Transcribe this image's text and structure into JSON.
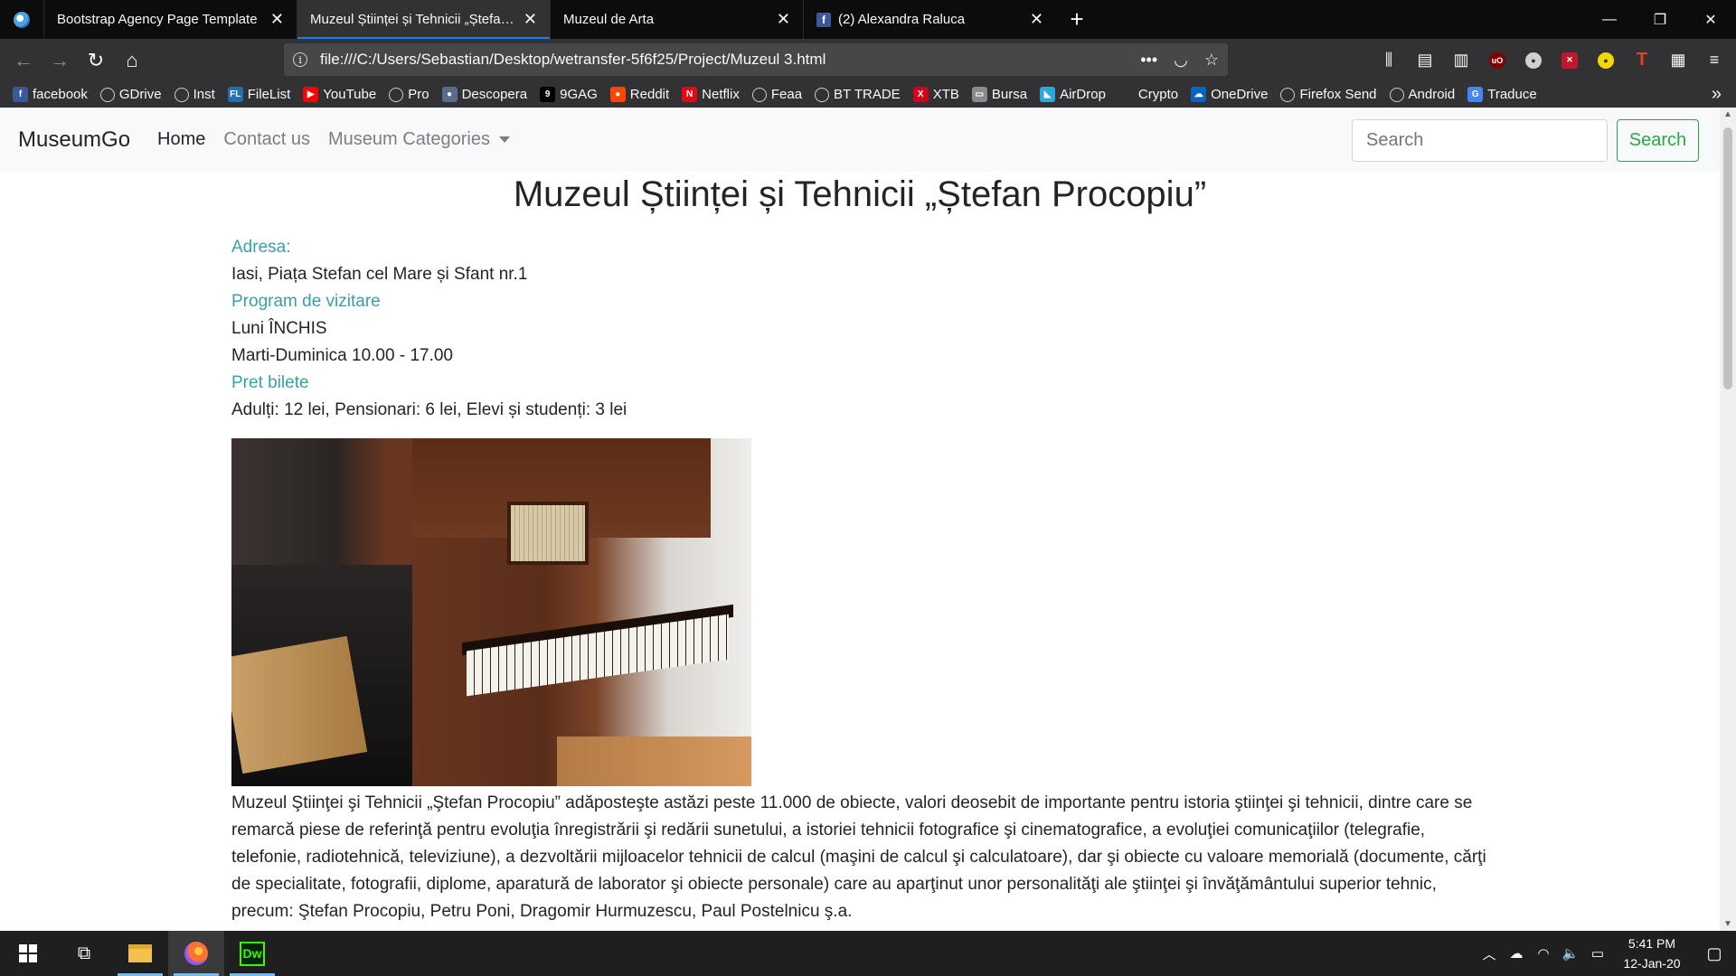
{
  "browser": {
    "tabs": [
      {
        "title": "Bootstrap Agency Page Template",
        "active": false,
        "favicon": "globe-icon"
      },
      {
        "title": "Muzeul Științei și Tehnicii „Ștefan Procopiu”",
        "active": true,
        "favicon": "page-icon"
      },
      {
        "title": "Muzeul de Arta",
        "active": false,
        "favicon": "page-icon"
      },
      {
        "title": "(2) Alexandra Raluca",
        "active": false,
        "favicon": "facebook-icon"
      }
    ],
    "url": "file:///C:/Users/Sebastian/Desktop/wetransfer-5f6f25/Project/Muzeul 3.html",
    "bookmarks": [
      {
        "label": "facebook",
        "icon": "facebook-icon",
        "color": "#3b5998",
        "glyph": "f"
      },
      {
        "label": "GDrive",
        "icon": "globe-icon"
      },
      {
        "label": "Inst",
        "icon": "globe-icon"
      },
      {
        "label": "FileList",
        "icon": "filelist-icon",
        "color": "#1e6fb3",
        "glyph": "FL"
      },
      {
        "label": "YouTube",
        "icon": "youtube-icon",
        "color": "#ff0000",
        "glyph": "▶"
      },
      {
        "label": "Pro",
        "icon": "globe-icon"
      },
      {
        "label": "Descopera",
        "icon": "descopera-icon",
        "color": "#5a6b8c",
        "glyph": "●"
      },
      {
        "label": "9GAG",
        "icon": "9gag-icon",
        "color": "#000000",
        "glyph": "9"
      },
      {
        "label": "Reddit",
        "icon": "reddit-icon",
        "color": "#ff4500",
        "glyph": "●"
      },
      {
        "label": "Netflix",
        "icon": "netflix-icon",
        "color": "#e50914",
        "glyph": "N"
      },
      {
        "label": "Feaa",
        "icon": "globe-icon"
      },
      {
        "label": "BT TRADE",
        "icon": "globe-icon"
      },
      {
        "label": "XTB",
        "icon": "xtb-icon",
        "color": "#d4001a",
        "glyph": "X"
      },
      {
        "label": "Bursa",
        "icon": "folder-icon",
        "color": "#8a8a8e",
        "glyph": "▭"
      },
      {
        "label": "AirDrop",
        "icon": "airdrop-icon",
        "color": "#2aa7e0",
        "glyph": "◣"
      },
      {
        "label": "Crypto",
        "icon": "crypto-icon",
        "color": "#323234",
        "glyph": ""
      },
      {
        "label": "OneDrive",
        "icon": "onedrive-icon",
        "color": "#0a64c8",
        "glyph": "☁"
      },
      {
        "label": "Firefox Send",
        "icon": "globe-icon"
      },
      {
        "label": "Android",
        "icon": "globe-icon"
      },
      {
        "label": "Traduce",
        "icon": "translate-icon",
        "color": "#4285f4",
        "glyph": "G"
      }
    ]
  },
  "site": {
    "brand": "MuseumGo",
    "nav": [
      {
        "label": "Home",
        "active": true
      },
      {
        "label": "Contact us",
        "active": false
      },
      {
        "label": "Museum Categories",
        "active": false,
        "dropdown": true
      }
    ],
    "search_placeholder": "Search",
    "search_button": "Search"
  },
  "museum": {
    "title": "Muzeul Științei și Tehnicii „Ștefan Procopiu”",
    "address_label": "Adresa:",
    "address": "Iasi, Piața Stefan cel Mare și Sfant nr.1",
    "schedule_label": "Program de vizitare",
    "schedule_monday": "Luni ÎNCHIS",
    "schedule_week": "Marti-Duminica 10.00 - 17.00",
    "tickets_label": "Pret bilete",
    "tickets": "Adulți: 12 lei, Pensionari: 6 lei, Elevi și studenți: 3 lei",
    "description": "Muzeul Ştiinţei şi Tehnicii „Ştefan Procopiu” adăposteşte astăzi peste 11.000 de obiecte, valori deosebit de importante pentru istoria ştiinţei şi tehnicii, dintre care se remarcă piese de referinţă pentru evoluţia înregistrării şi redării sunetului, a istoriei tehnicii fotografice şi cinematografice, a evoluţiei comunicaţiilor (telegrafie, telefonie, radiotehnică, televiziune), a dezvoltării mijloacelor tehnicii de calcul (maşini de calcul şi calculatoare), dar şi obiecte cu valoare memorială (documente, cărţi de specialitate, fotografii, diplome, aparatură de laborator şi obiecte personale) care au aparţinut unor personalităţi ale ştiinţei şi învăţământului superior tehnic, precum: Ştefan Procopiu, Petru Poni, Dragomir Hurmuzescu, Paul Postelnicu ş.a."
  },
  "taskbar": {
    "time": "5:41 PM",
    "date": "12-Jan-20"
  }
}
